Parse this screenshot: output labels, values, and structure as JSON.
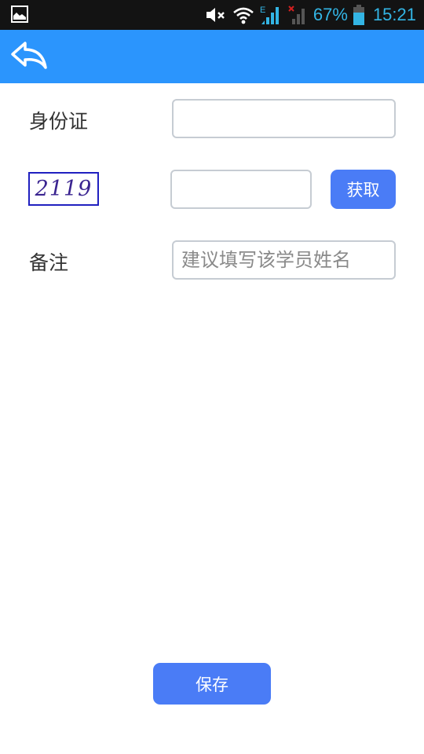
{
  "status_bar": {
    "battery_percent": "67%",
    "time": "15:21",
    "network_label": "E",
    "icons": [
      "gallery-icon",
      "mute-icon",
      "wifi-icon",
      "signal-icon",
      "no-signal-icon",
      "battery-icon"
    ]
  },
  "app_bar": {
    "back_icon": "reply-arrow-icon"
  },
  "form": {
    "id_card": {
      "label": "身份证",
      "value": "",
      "placeholder": ""
    },
    "captcha": {
      "image_text": "2119",
      "value": "",
      "placeholder": "",
      "fetch_label": "获取"
    },
    "remark": {
      "label": "备注",
      "value": "",
      "placeholder": "建议填写该学员姓名"
    }
  },
  "actions": {
    "save_label": "保存"
  },
  "colors": {
    "app_bar": "#2b95fd",
    "button": "#4a7cf6",
    "status_accent": "#33b5e5"
  }
}
